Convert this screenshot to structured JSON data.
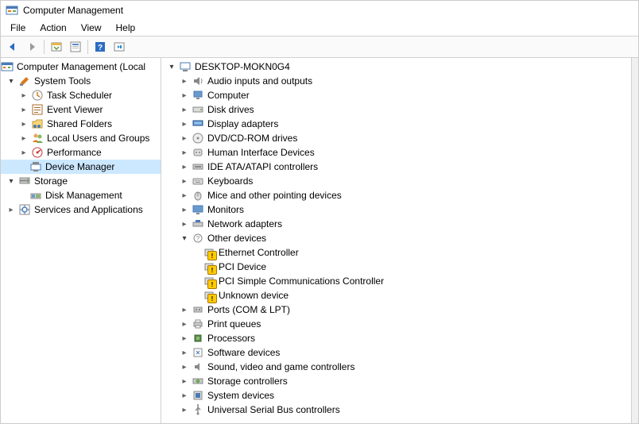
{
  "window": {
    "title": "Computer Management"
  },
  "menu": {
    "file": "File",
    "action": "Action",
    "view": "View",
    "help": "Help"
  },
  "left_tree": {
    "root": "Computer Management (Local",
    "system_tools": "System Tools",
    "task_scheduler": "Task Scheduler",
    "event_viewer": "Event Viewer",
    "shared_folders": "Shared Folders",
    "local_users": "Local Users and Groups",
    "performance": "Performance",
    "device_manager": "Device Manager",
    "storage": "Storage",
    "disk_management": "Disk Management",
    "services_apps": "Services and Applications"
  },
  "right_tree": {
    "root": "DESKTOP-MOKN0G4",
    "audio": "Audio inputs and outputs",
    "computer": "Computer",
    "disk_drives": "Disk drives",
    "display_adapters": "Display adapters",
    "dvd": "DVD/CD-ROM drives",
    "hid": "Human Interface Devices",
    "ide": "IDE ATA/ATAPI controllers",
    "keyboards": "Keyboards",
    "mice": "Mice and other pointing devices",
    "monitors": "Monitors",
    "network": "Network adapters",
    "other": "Other devices",
    "ethernet": "Ethernet Controller",
    "pci": "PCI Device",
    "pci_simple": "PCI Simple Communications Controller",
    "unknown": "Unknown device",
    "ports": "Ports (COM & LPT)",
    "print_queues": "Print queues",
    "processors": "Processors",
    "software_devices": "Software devices",
    "sound": "Sound, video and game controllers",
    "storage_ctrl": "Storage controllers",
    "system_devices": "System devices",
    "usb": "Universal Serial Bus controllers"
  }
}
